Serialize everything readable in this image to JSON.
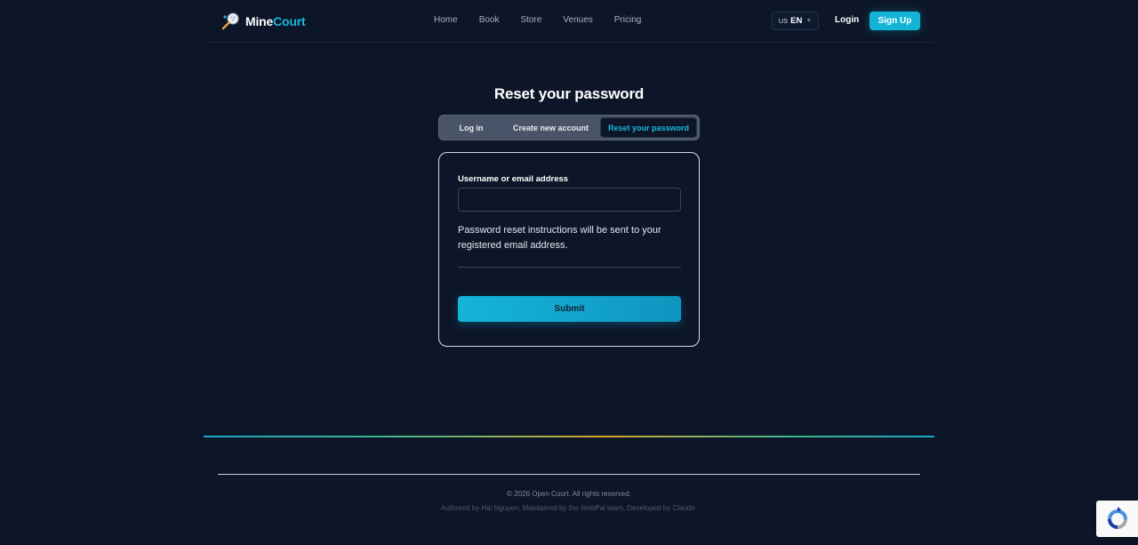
{
  "brand": {
    "name_part1": "Mine",
    "name_part2": "Court",
    "icon": "paddle-ball-icon"
  },
  "nav": [
    {
      "label": "Home"
    },
    {
      "label": "Book"
    },
    {
      "label": "Store"
    },
    {
      "label": "Venues"
    },
    {
      "label": "Pricing"
    }
  ],
  "language": {
    "flag": "US",
    "code": "EN",
    "icon": "chevron-down-icon"
  },
  "auth": {
    "login_label": "Login",
    "signup_label": "Sign Up"
  },
  "page": {
    "title": "Reset your password"
  },
  "tabs": [
    {
      "label": "Log in",
      "active": false
    },
    {
      "label": "Create new account",
      "active": false
    },
    {
      "label": "Reset your password",
      "active": true
    }
  ],
  "form": {
    "field_label": "Username or email address",
    "field_value": "",
    "help_text": "Password reset instructions will be sent to your registered email address.",
    "submit_label": "Submit"
  },
  "footer": {
    "copyright": "© 2026 Open Court. All rights reserved.",
    "credits": "Authored by Hai Nguyen, Maintained by the WebPal team, Developed by Claude."
  },
  "recaptcha": {
    "icon": "recaptcha-icon"
  },
  "colors": {
    "background": "#0d1628",
    "accent": "#14b4d6",
    "accent_gradient_mid": "#d9a62a"
  }
}
